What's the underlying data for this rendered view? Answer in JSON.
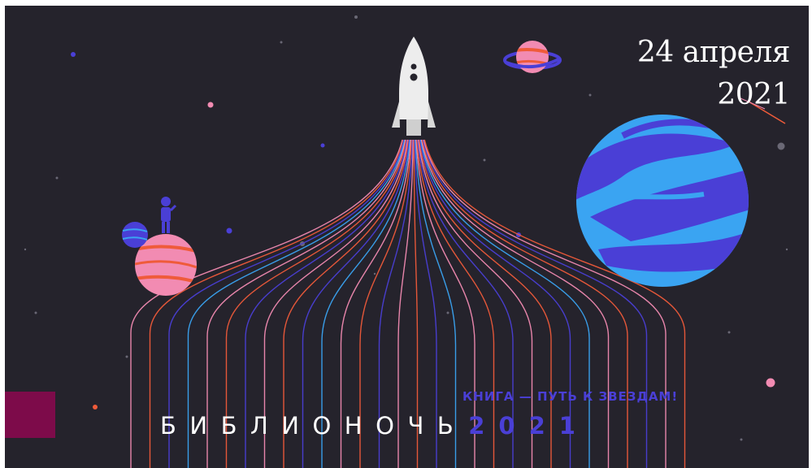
{
  "event": {
    "date_line1": "24 апреля",
    "date_line2": "2021",
    "tagline": "КНИГА — ПУТЬ К ЗВЕЗДАМ!",
    "title_word": "БИБЛИОНОЧЬ",
    "title_year": "2021"
  },
  "colors": {
    "background": "#25232c",
    "accent_blue": "#4a3fd6",
    "accent_pink": "#f28bb2",
    "accent_orange": "#ef5b3a",
    "planet_blue": "#3aa4f2",
    "side_block": "#7d0b4a"
  },
  "icons": [
    "rocket-icon",
    "ringed-planet-icon",
    "blue-planet-icon",
    "pink-planet-icon",
    "astronaut-icon"
  ]
}
